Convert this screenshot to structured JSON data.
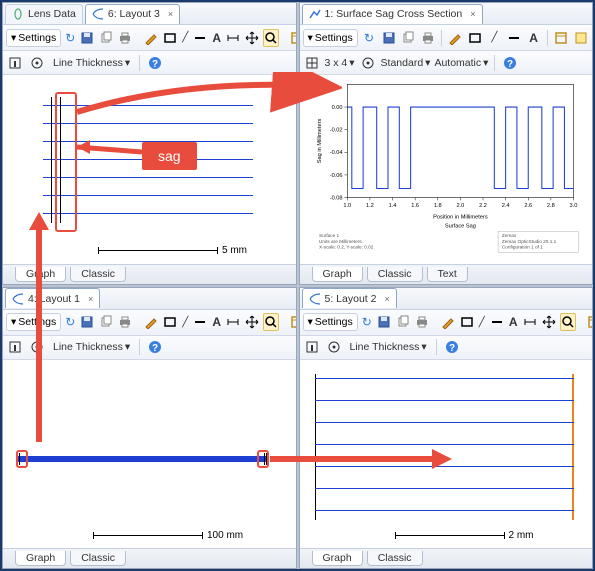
{
  "panels": {
    "tl": {
      "tabs": [
        {
          "label": "Lens Data"
        },
        {
          "label": "6: Layout 3",
          "active": true
        }
      ],
      "settings_label": "Settings",
      "line_thickness_label": "Line Thickness",
      "scale_label": "5 mm",
      "bottom": [
        {
          "label": "Graph",
          "active": true
        },
        {
          "label": "Classic"
        }
      ]
    },
    "tr": {
      "tabs": [
        {
          "label": "1: Surface Sag Cross Section",
          "active": true
        }
      ],
      "settings_label": "Settings",
      "row2": {
        "size_label": "3 x 4",
        "mode_label": "Standard",
        "auto_label": "Automatic"
      },
      "bottom": [
        {
          "label": "Graph",
          "active": true
        },
        {
          "label": "Classic"
        },
        {
          "label": "Text"
        }
      ]
    },
    "bl": {
      "tabs": [
        {
          "label": "4: Layout 1",
          "active": true
        }
      ],
      "settings_label": "Settings",
      "line_thickness_label": "Line Thickness",
      "scale_label": "100 mm",
      "bottom": [
        {
          "label": "Graph",
          "active": true
        },
        {
          "label": "Classic"
        }
      ]
    },
    "br": {
      "tabs": [
        {
          "label": "5: Layout 2",
          "active": true
        }
      ],
      "settings_label": "Settings",
      "line_thickness_label": "Line Thickness",
      "scale_label": "2 mm",
      "bottom": [
        {
          "label": "Graph",
          "active": true
        },
        {
          "label": "Classic"
        }
      ]
    }
  },
  "annotations": {
    "sag_label": "sag"
  },
  "icons": {
    "refresh": "↻",
    "chevron": "▾",
    "close": "×",
    "help": "?",
    "expand": "⤢"
  },
  "chart_data": {
    "type": "line",
    "title": "Surface Sag",
    "xlabel": "Position in Millimeters",
    "ylabel": "Sag in Millimeters",
    "xlim": [
      1.0,
      3.0
    ],
    "ylim": [
      -0.08,
      0.02
    ],
    "xticks": [
      1.0,
      1.2,
      1.4,
      1.6,
      1.8,
      2.0,
      2.2,
      2.4,
      2.6,
      2.8,
      3.0
    ],
    "yticks": [
      0.0,
      -0.02,
      -0.04,
      -0.06,
      -0.08
    ],
    "series": [
      {
        "name": "sag",
        "color": "#1e3fd4",
        "x": [
          1.0,
          1.04,
          1.04,
          1.14,
          1.14,
          1.26,
          1.26,
          1.36,
          1.36,
          1.46,
          1.46,
          1.56,
          1.56,
          2.3,
          2.3,
          2.4,
          2.4,
          2.5,
          2.5,
          2.6,
          2.6,
          2.72,
          2.72,
          2.82,
          2.82,
          2.92,
          2.92,
          3.0
        ],
        "y": [
          0.0,
          0.0,
          -0.072,
          -0.072,
          0.0,
          0.0,
          -0.072,
          -0.072,
          0.0,
          0.0,
          -0.072,
          -0.072,
          0.0,
          0.0,
          -0.072,
          -0.072,
          0.0,
          0.0,
          -0.072,
          -0.072,
          0.0,
          0.0,
          -0.072,
          -0.072,
          0.0,
          0.0,
          -0.072,
          -0.072
        ]
      }
    ],
    "footer_lines": [
      "Surface 1",
      "Units are Millimeters.",
      "X-scale: 0.2, Y-scale: 0.02"
    ],
    "footer_right": [
      "Zemax",
      "Zemax OpticStudio 20.1.1",
      "Configuration 1 of 1"
    ]
  }
}
